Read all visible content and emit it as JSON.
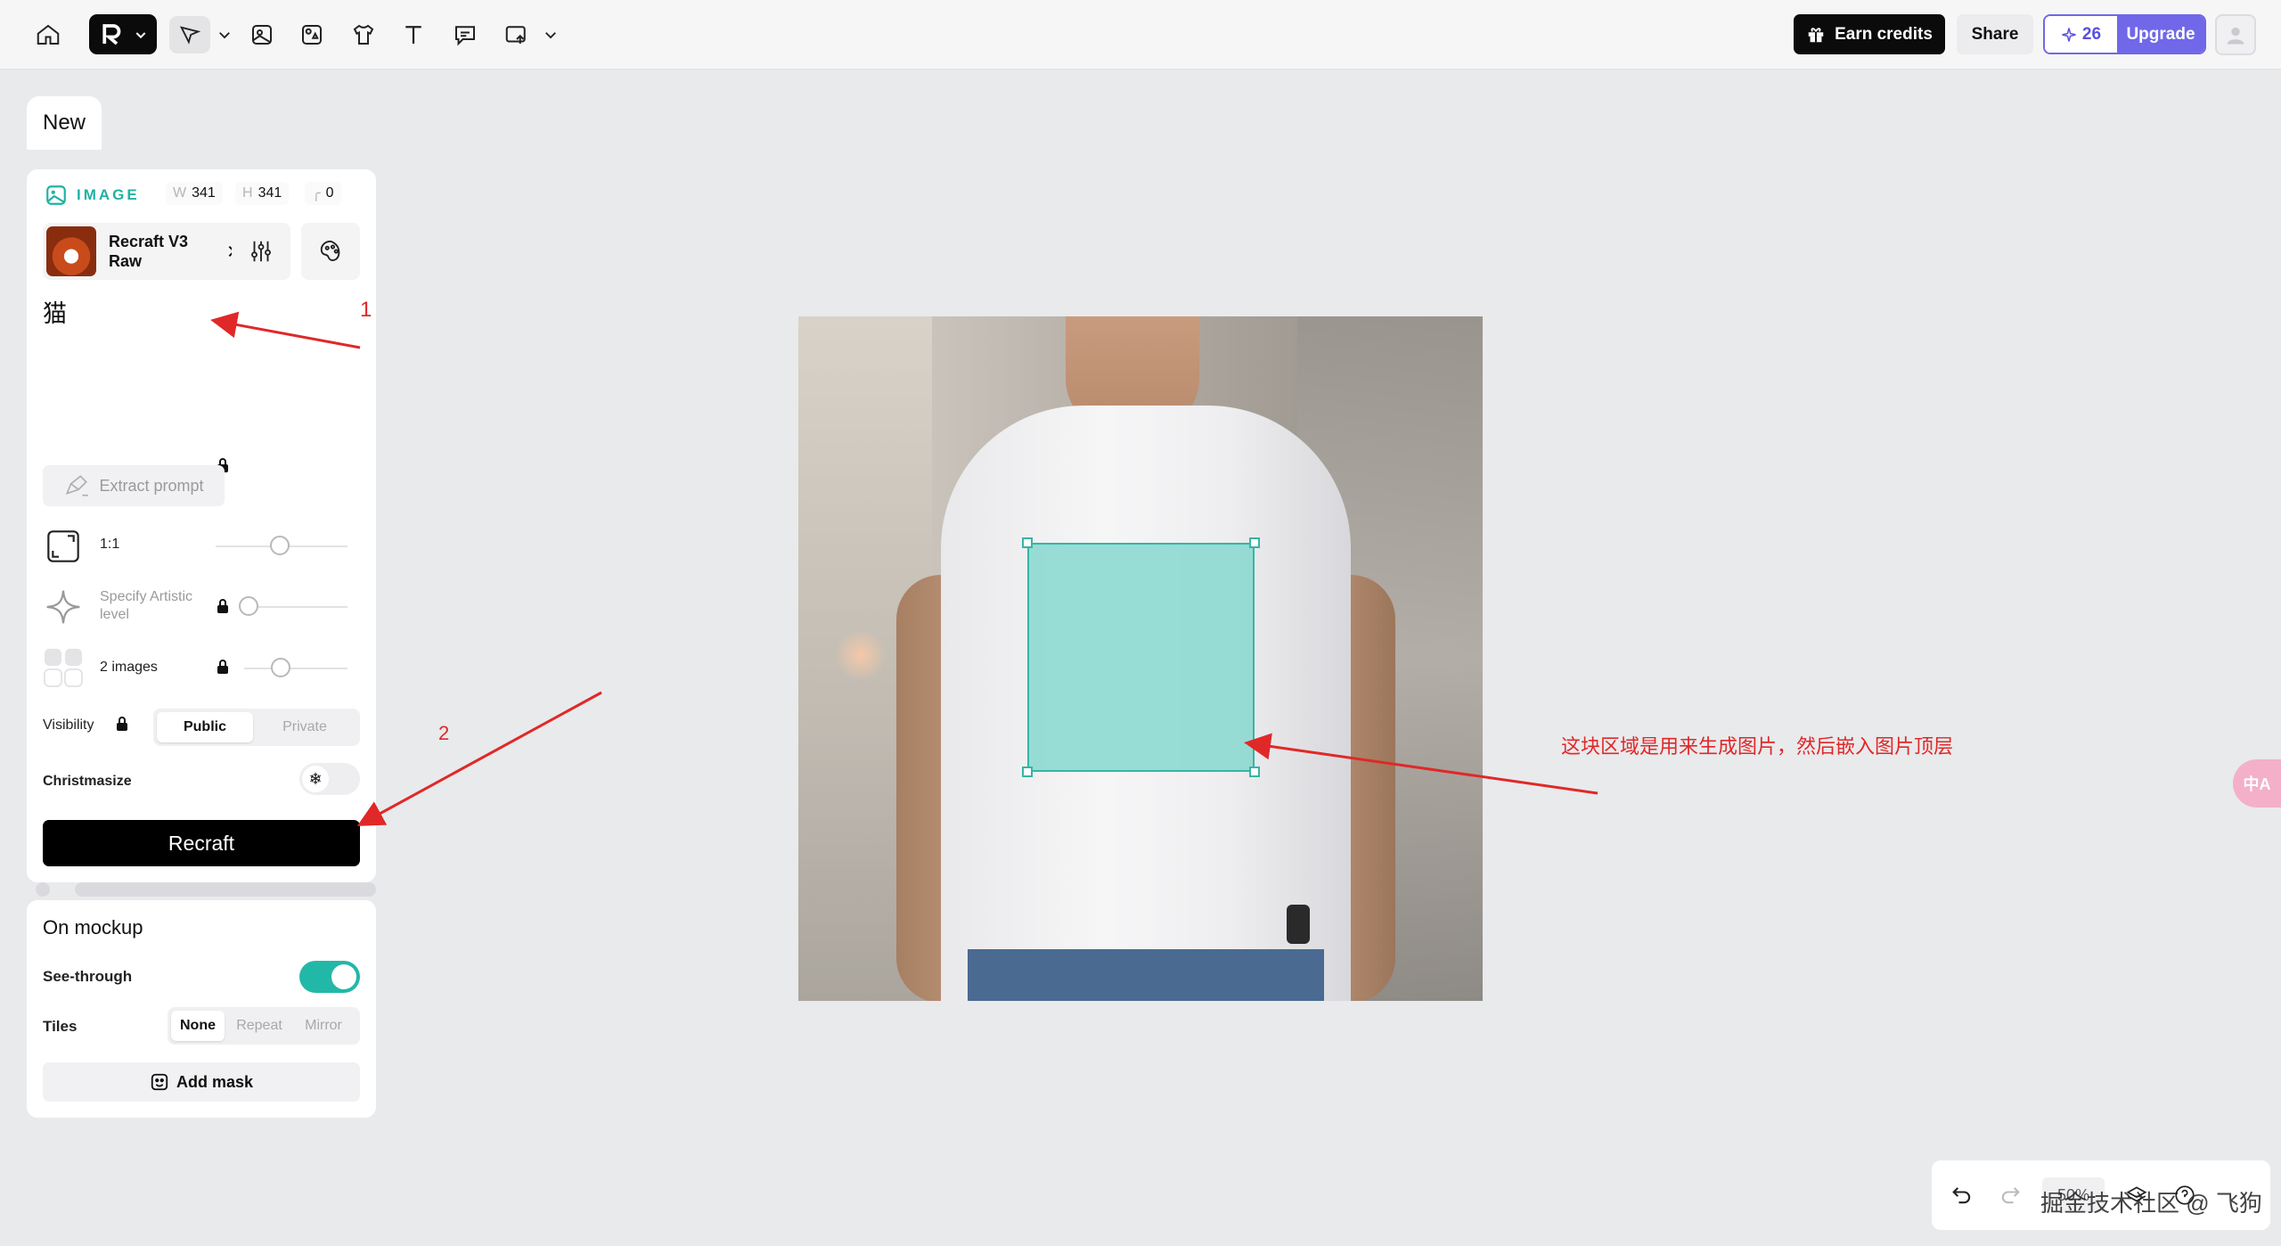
{
  "topbar": {
    "earn_credits": "Earn credits",
    "share": "Share",
    "credits_count": "26",
    "upgrade": "Upgrade"
  },
  "panel": {
    "new_tab": "New",
    "section_label": "IMAGE",
    "width_key": "W",
    "width": "341",
    "height_key": "H",
    "height": "341",
    "radius": "0",
    "model_name": "Recraft V3 Raw",
    "prompt": "猫",
    "extract_prompt": "Extract prompt",
    "aspect_ratio": "1:1",
    "artistic_level": "Specify Artistic level",
    "images_count": "2 images",
    "visibility_label": "Visibility",
    "visibility_options": [
      "Public",
      "Private"
    ],
    "visibility_selected": "Public",
    "christmasize_label": "Christmasize",
    "recraft_button": "Recraft"
  },
  "mockup": {
    "title": "On mockup",
    "see_through_label": "See-through",
    "see_through_on": true,
    "tiles_label": "Tiles",
    "tiles_options": [
      "None",
      "Repeat",
      "Mirror"
    ],
    "tiles_selected": "None",
    "add_mask": "Add mask"
  },
  "annotations": {
    "marker1": "1",
    "marker2": "2",
    "note": "这块区域是用来生成图片，然后嵌入图片顶层"
  },
  "bottom": {
    "zoom": "50%",
    "watermark": "掘金技术社区 @ 飞狗"
  },
  "side_tab": "中A",
  "colors": {
    "accent_teal": "#22b8a8",
    "brand_purple": "#7068e8",
    "annotation_red": "#e02828"
  }
}
